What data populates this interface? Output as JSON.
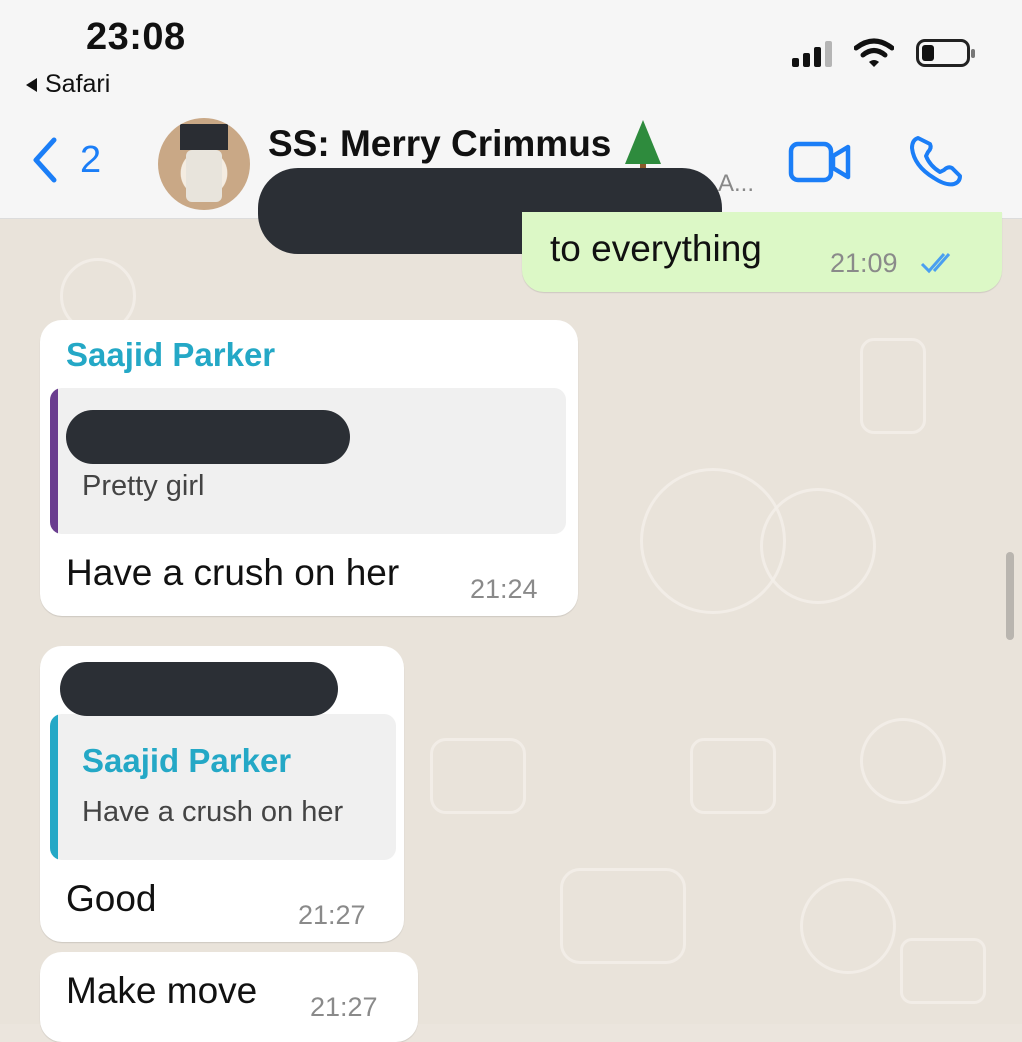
{
  "status_bar": {
    "time": "23:08",
    "back_app": "Safari"
  },
  "header": {
    "back_count": "2",
    "chat_title": "SS: Merry Crimmus",
    "subtitle_tail": "A..."
  },
  "messages": {
    "m1": {
      "text": "to everything",
      "time": "21:09",
      "status": "read"
    },
    "m2": {
      "sender": "Saajid Parker",
      "quote_text": "Pretty girl",
      "text": "Have a crush on her",
      "time": "21:24"
    },
    "m3": {
      "quote_sender": "Saajid Parker",
      "quote_text": "Have a crush on her",
      "text": "Good",
      "time": "21:27"
    },
    "m4": {
      "text": "Make move",
      "time": "21:27"
    }
  },
  "colors": {
    "accent": "#1b7ef7",
    "sender_name": "#24a8c6",
    "outgoing_bubble": "#dcf8c6",
    "incoming_bubble": "#ffffff",
    "quote_bar_purple": "#6a3d8f",
    "quote_bar_teal": "#24a8c6",
    "redaction": "#2b2f35"
  }
}
